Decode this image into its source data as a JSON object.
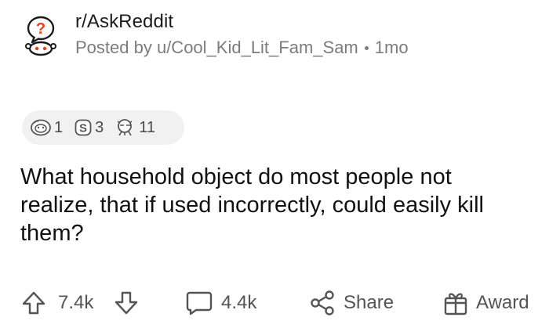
{
  "header": {
    "subreddit": "r/AskReddit",
    "posted_by": "Posted by u/Cool_Kid_Lit_Fam_Sam",
    "age": "1mo"
  },
  "awards": [
    {
      "icon": "helpful-award-icon",
      "count": "1"
    },
    {
      "icon": "silver-award-icon",
      "count": "3"
    },
    {
      "icon": "wholesome-award-icon",
      "count": "11"
    }
  ],
  "post": {
    "title": "What household object do most people not realize, that if used incorrectly, could easily kill them?"
  },
  "actions": {
    "upvotes": "7.4k",
    "comments": "4.4k",
    "share_label": "Share",
    "award_label": "Award"
  },
  "colors": {
    "icon_orange": "#e8441b",
    "muted_text": "#7c7c7c",
    "pill_bg": "#f1f1f1"
  }
}
